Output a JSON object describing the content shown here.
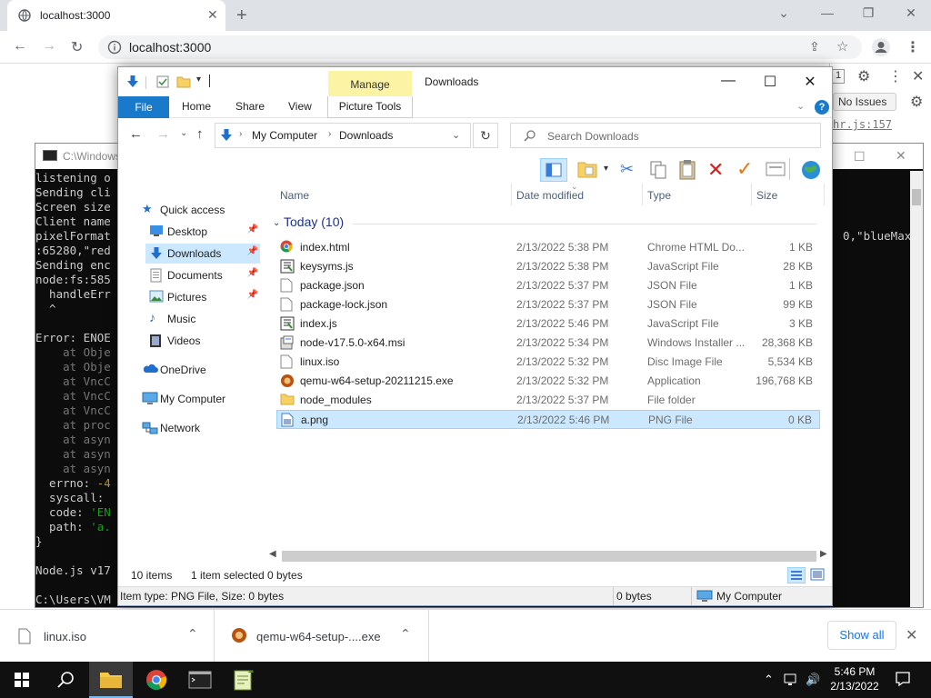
{
  "browser": {
    "tab_title": "localhost:3000",
    "url": "localhost:3000",
    "devtools_issues": "No Issues",
    "devtools_source": "hr.js:157",
    "devtools_badge": "1"
  },
  "console": {
    "title": "C:\\Windows",
    "lines": [
      "listening o",
      "Sending cli",
      "Screen size",
      "Client name",
      "pixelFormat",
      ":65280,\"red",
      "Sending enc",
      "node:fs:585",
      "  handleErr",
      "  ^",
      "",
      "Error: ENOE",
      "    at Obje",
      "    at Obje",
      "    at VncC",
      "    at VncC",
      "    at VncC",
      "    at proc",
      "    at asyn",
      "    at asyn",
      "    at asyn",
      "  errno: -4",
      "  syscall: ",
      "  code: 'EN",
      "  path: 'a.",
      "}",
      "",
      "Node.js v17",
      "",
      "C:\\Users\\VM"
    ],
    "right_fragment": "0,\"blueMax\""
  },
  "explorer": {
    "window_title": "Downloads",
    "manage_label": "Manage",
    "ribbon_tabs": [
      "File",
      "Home",
      "Share",
      "View",
      "Picture Tools"
    ],
    "breadcrumb": [
      "My Computer",
      "Downloads"
    ],
    "search_placeholder": "Search Downloads",
    "nav": {
      "quick_access": "Quick access",
      "items": [
        {
          "label": "Desktop",
          "pinned": true
        },
        {
          "label": "Downloads",
          "pinned": true,
          "selected": true
        },
        {
          "label": "Documents",
          "pinned": true
        },
        {
          "label": "Pictures",
          "pinned": true
        },
        {
          "label": "Music",
          "pinned": false
        },
        {
          "label": "Videos",
          "pinned": false
        }
      ],
      "onedrive": "OneDrive",
      "my_computer": "My Computer",
      "network": "Network"
    },
    "columns": {
      "name": "Name",
      "date": "Date modified",
      "type": "Type",
      "size": "Size"
    },
    "group_label": "Today (10)",
    "files": [
      {
        "name": "index.html",
        "date": "2/13/2022 5:38 PM",
        "type": "Chrome HTML Do...",
        "size": "1 KB",
        "icon": "chrome-icon"
      },
      {
        "name": "keysyms.js",
        "date": "2/13/2022 5:38 PM",
        "type": "JavaScript File",
        "size": "28 KB",
        "icon": "script-icon"
      },
      {
        "name": "package.json",
        "date": "2/13/2022 5:37 PM",
        "type": "JSON File",
        "size": "1 KB",
        "icon": "document-icon"
      },
      {
        "name": "package-lock.json",
        "date": "2/13/2022 5:37 PM",
        "type": "JSON File",
        "size": "99 KB",
        "icon": "document-icon"
      },
      {
        "name": "index.js",
        "date": "2/13/2022 5:46 PM",
        "type": "JavaScript File",
        "size": "3 KB",
        "icon": "script-icon"
      },
      {
        "name": "node-v17.5.0-x64.msi",
        "date": "2/13/2022 5:34 PM",
        "type": "Windows Installer ...",
        "size": "28,368 KB",
        "icon": "installer-icon"
      },
      {
        "name": "linux.iso",
        "date": "2/13/2022 5:32 PM",
        "type": "Disc Image File",
        "size": "5,534 KB",
        "icon": "document-icon"
      },
      {
        "name": "qemu-w64-setup-20211215.exe",
        "date": "2/13/2022 5:32 PM",
        "type": "Application",
        "size": "196,768 KB",
        "icon": "qemu-icon"
      },
      {
        "name": "node_modules",
        "date": "2/13/2022 5:37 PM",
        "type": "File folder",
        "size": "",
        "icon": "folder-icon"
      },
      {
        "name": "a.png",
        "date": "2/13/2022 5:46 PM",
        "type": "PNG File",
        "size": "0 KB",
        "icon": "image-icon",
        "selected": true
      }
    ],
    "status": {
      "count": "10 items",
      "selected": "1 item selected",
      "size": "0 bytes"
    },
    "details": {
      "info": "Item type: PNG File, Size: 0 bytes",
      "size": "0 bytes",
      "location": "My Computer"
    }
  },
  "downloads_bar": {
    "items": [
      "linux.iso",
      "qemu-w64-setup-....exe"
    ],
    "show_all": "Show all"
  },
  "taskbar": {
    "time": "5:46 PM",
    "date": "2/13/2022"
  }
}
